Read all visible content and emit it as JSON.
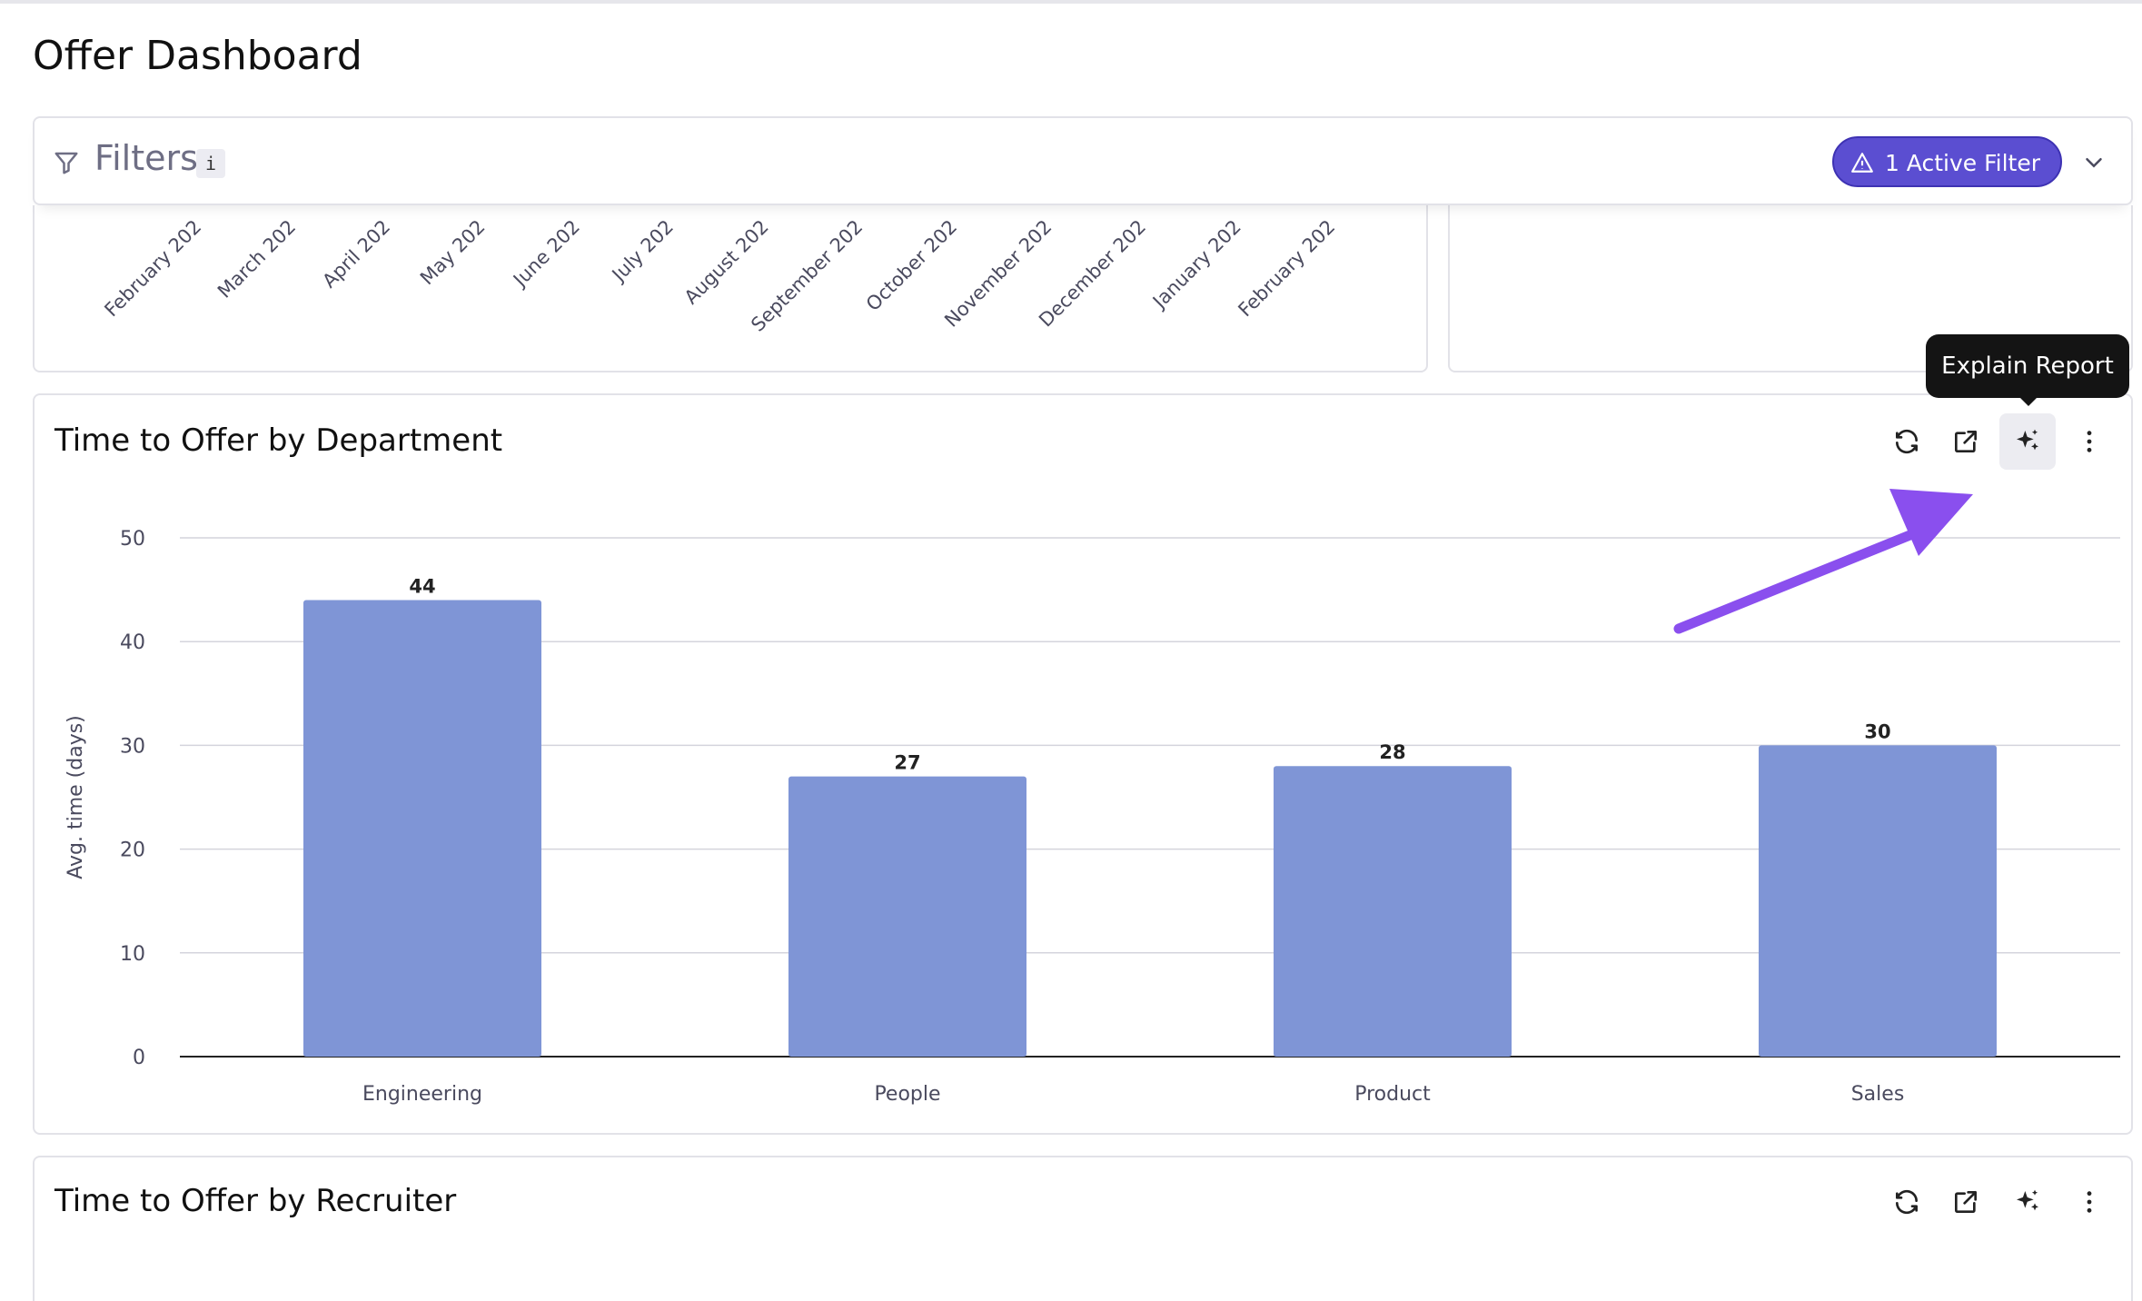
{
  "page": {
    "title": "Offer Dashboard"
  },
  "filters": {
    "label": "Filters",
    "info": "i",
    "active_label": "1 Active Filter"
  },
  "previous_chart": {
    "x_labels": [
      "February 202",
      "March 202",
      "April 202",
      "May 202",
      "June 202",
      "July 202",
      "August 202",
      "September 202",
      "October 202",
      "November 202",
      "December 202",
      "January 202",
      "February 202"
    ]
  },
  "tooltip": {
    "text": "Explain Report"
  },
  "cards": {
    "department": {
      "title": "Time to Offer by Department"
    },
    "recruiter": {
      "title": "Time to Offer by Recruiter"
    }
  },
  "actions": {
    "refresh": "refresh-icon",
    "open": "external-link-icon",
    "explain": "sparkle-icon",
    "more": "more-vertical-icon"
  },
  "colors": {
    "bar": "#7f95d6",
    "accent": "#5b4ed1",
    "arrow": "#8a4fee"
  },
  "chart_data": {
    "type": "bar",
    "categories": [
      "Engineering",
      "People",
      "Product",
      "Sales"
    ],
    "values": [
      44,
      27,
      28,
      30
    ],
    "data_labels": [
      "44",
      "27",
      "28",
      "30"
    ],
    "title": "Time to Offer by Department",
    "xlabel": "",
    "ylabel": "Avg. time (days)",
    "ylim": [
      0,
      50
    ],
    "yticks": [
      0,
      10,
      20,
      30,
      40,
      50
    ],
    "grid": true,
    "legend": "none"
  }
}
